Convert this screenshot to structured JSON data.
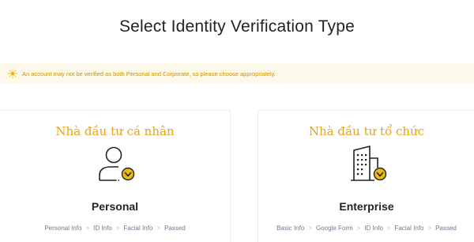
{
  "page": {
    "title": "Select Identity Verification Type"
  },
  "notice": {
    "icon": "lightbulb-icon",
    "text": "An account may not be verified as both Personal and Corporate, so please choose appropriately.",
    "color": "#c99400",
    "background": "#fdf9ea"
  },
  "personal": {
    "annotation": "Nhà đầu tư cá nhân",
    "icon": "personal-user-check-icon",
    "title": "Personal",
    "steps": [
      "Personal Info",
      "ID Info",
      "Facial Info",
      "Passed"
    ]
  },
  "enterprise": {
    "annotation": "Nhà đầu tư tổ chức",
    "icon": "enterprise-building-check-icon",
    "title": "Enterprise",
    "steps": [
      "Basic Info",
      "Google Form",
      "ID Info",
      "Facial Info",
      "Passed"
    ]
  },
  "colors": {
    "accent": "#f0b90b",
    "annotation": "#e8a317",
    "text_primary": "#1e2329",
    "text_secondary": "#707a8a"
  }
}
